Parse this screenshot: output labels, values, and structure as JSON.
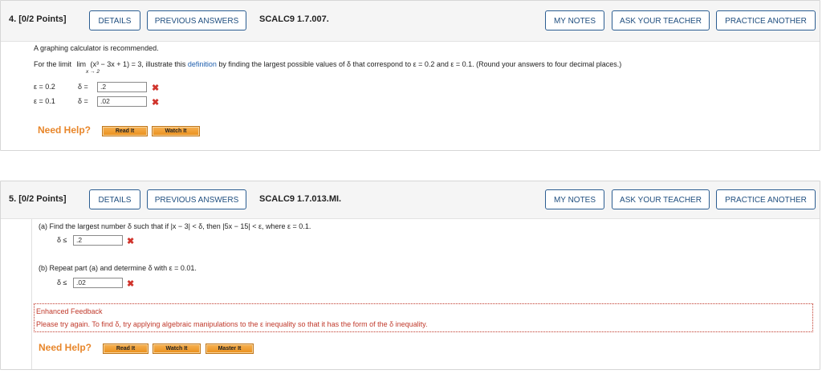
{
  "q4": {
    "number": "4.",
    "points": "[0/2 Points]",
    "buttons": {
      "details": "DETAILS",
      "previous_answers": "PREVIOUS ANSWERS",
      "my_notes": "MY NOTES",
      "ask_teacher": "ASK YOUR TEACHER",
      "practice_another": "PRACTICE ANOTHER"
    },
    "problem_id": "SCALC9 1.7.007.",
    "calculator_note": "A graphing calculator is recommended.",
    "prompt_prefix": "For the limit",
    "limit_word": "lim",
    "limit_sub": "x → 2",
    "limit_expr": "(x³ − 3x + 1) = 3, illustrate this",
    "definition_link": "definition",
    "prompt_suffix": "by finding the largest possible values of δ that correspond to ε = 0.2 and ε = 0.1. (Round your answers to four decimal places.)",
    "rows": [
      {
        "eps": "ε = 0.2",
        "delta": "δ =",
        "value": ".2"
      },
      {
        "eps": "ε = 0.1",
        "delta": "δ =",
        "value": ".02"
      }
    ],
    "need_help": "Need Help?",
    "help_buttons": {
      "read": "Read It",
      "watch": "Watch It"
    }
  },
  "q5": {
    "number": "5.",
    "points": "[0/2 Points]",
    "buttons": {
      "details": "DETAILS",
      "previous_answers": "PREVIOUS ANSWERS",
      "my_notes": "MY NOTES",
      "ask_teacher": "ASK YOUR TEACHER",
      "practice_another": "PRACTICE ANOTHER"
    },
    "problem_id": "SCALC9 1.7.013.MI.",
    "part_a": "(a)   Find the largest number δ such that if |x − 3| < δ, then |5x − 15| < ε, where ε = 0.1.",
    "part_a_label": "δ ≤",
    "part_a_value": ".2",
    "part_b": "(b)   Repeat part (a) and determine δ with ε = 0.01.",
    "part_b_label": "δ ≤",
    "part_b_value": ".02",
    "feedback_title": "Enhanced Feedback",
    "feedback_text": "Please try again. To find δ, try applying algebraic manipulations to the ε inequality so that it has the form of the δ inequality.",
    "need_help": "Need Help?",
    "help_buttons": {
      "read": "Read It",
      "watch": "Watch It",
      "master": "Master It"
    }
  },
  "icons": {
    "incorrect": "incorrect-x-icon"
  },
  "colors": {
    "accent": "#1f4e7f",
    "incorrect": "#d0342c",
    "help": "#e8862a",
    "feedback": "#c0392b"
  }
}
